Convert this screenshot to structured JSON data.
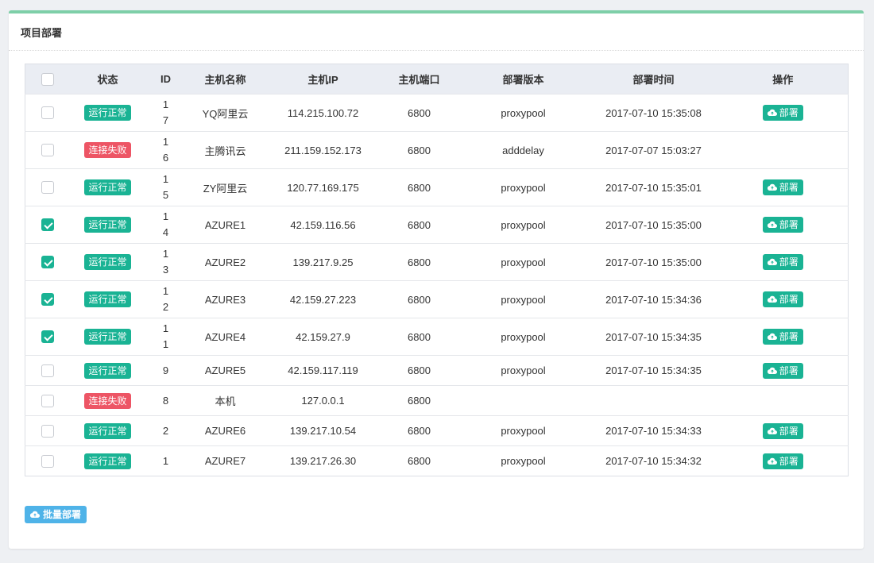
{
  "panel": {
    "title": "项目部署"
  },
  "columns": [
    "状态",
    "ID",
    "主机名称",
    "主机IP",
    "主机端口",
    "部署版本",
    "部署时间",
    "操作"
  ],
  "deploy_label": "部署",
  "batch_label": "批量部署",
  "status": {
    "ok": "运行正常",
    "fail": "连接失败"
  },
  "colors": {
    "accent": "#1ab394",
    "danger": "#ed5565",
    "batch": "#4fb3e8",
    "header_bar": "#7ecfa8"
  },
  "icons": {
    "deploy": "cloud-upload-icon",
    "check": "checkmark-icon"
  },
  "rows": [
    {
      "checked": false,
      "status": "运行正常",
      "ok": true,
      "id": "17",
      "host": "YQ阿里云",
      "ip": "114.215.100.72",
      "port": "6800",
      "version": "proxypool",
      "time": "2017-07-10 15:35:08",
      "deploy": true
    },
    {
      "checked": false,
      "status": "连接失败",
      "ok": false,
      "id": "16",
      "host": "主腾讯云",
      "ip": "211.159.152.173",
      "port": "6800",
      "version": "adddelay",
      "time": "2017-07-07 15:03:27",
      "deploy": false
    },
    {
      "checked": false,
      "status": "运行正常",
      "ok": true,
      "id": "15",
      "host": "ZY阿里云",
      "ip": "120.77.169.175",
      "port": "6800",
      "version": "proxypool",
      "time": "2017-07-10 15:35:01",
      "deploy": true
    },
    {
      "checked": true,
      "status": "运行正常",
      "ok": true,
      "id": "14",
      "host": "AZURE1",
      "ip": "42.159.116.56",
      "port": "6800",
      "version": "proxypool",
      "time": "2017-07-10 15:35:00",
      "deploy": true
    },
    {
      "checked": true,
      "status": "运行正常",
      "ok": true,
      "id": "13",
      "host": "AZURE2",
      "ip": "139.217.9.25",
      "port": "6800",
      "version": "proxypool",
      "time": "2017-07-10 15:35:00",
      "deploy": true
    },
    {
      "checked": true,
      "status": "运行正常",
      "ok": true,
      "id": "12",
      "host": "AZURE3",
      "ip": "42.159.27.223",
      "port": "6800",
      "version": "proxypool",
      "time": "2017-07-10 15:34:36",
      "deploy": true
    },
    {
      "checked": true,
      "status": "运行正常",
      "ok": true,
      "id": "11",
      "host": "AZURE4",
      "ip": "42.159.27.9",
      "port": "6800",
      "version": "proxypool",
      "time": "2017-07-10 15:34:35",
      "deploy": true
    },
    {
      "checked": false,
      "status": "运行正常",
      "ok": true,
      "id": "9",
      "host": "AZURE5",
      "ip": "42.159.117.119",
      "port": "6800",
      "version": "proxypool",
      "time": "2017-07-10 15:34:35",
      "deploy": true
    },
    {
      "checked": false,
      "status": "连接失败",
      "ok": false,
      "id": "8",
      "host": "本机",
      "ip": "127.0.0.1",
      "port": "6800",
      "version": "",
      "time": "",
      "deploy": false
    },
    {
      "checked": false,
      "status": "运行正常",
      "ok": true,
      "id": "2",
      "host": "AZURE6",
      "ip": "139.217.10.54",
      "port": "6800",
      "version": "proxypool",
      "time": "2017-07-10 15:34:33",
      "deploy": true
    },
    {
      "checked": false,
      "status": "运行正常",
      "ok": true,
      "id": "1",
      "host": "AZURE7",
      "ip": "139.217.26.30",
      "port": "6800",
      "version": "proxypool",
      "time": "2017-07-10 15:34:32",
      "deploy": true
    }
  ]
}
